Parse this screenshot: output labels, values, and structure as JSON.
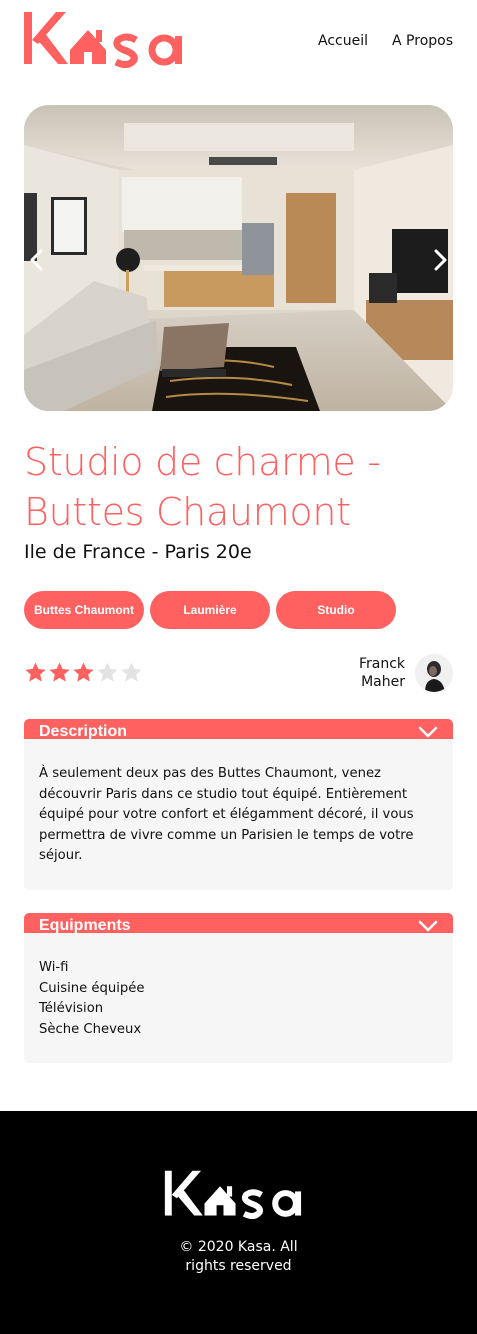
{
  "brand": {
    "logo_text": "Kasa",
    "accent_color": "#FF6060"
  },
  "nav": {
    "items": [
      {
        "label": "Accueil"
      },
      {
        "label": "A Propos"
      }
    ]
  },
  "carousel": {
    "prev_icon": "chevron-left-icon",
    "next_icon": "chevron-right-icon"
  },
  "listing": {
    "title": "Studio de charme - Buttes Chaumont",
    "location": "Ile de France - Paris 20e",
    "tags": [
      "Buttes Chaumont",
      "Laumière",
      "Studio"
    ],
    "rating": 3,
    "rating_max": 5,
    "host": {
      "first_name": "Franck",
      "last_name": "Maher"
    }
  },
  "description": {
    "title": "Description",
    "text": "À seulement deux pas des Buttes Chaumont, venez découvrir Paris dans ce studio tout équipé. Entièrement équipé pour votre confort et élégamment décoré, il vous permettra de vivre comme un Parisien le temps de votre séjour."
  },
  "equipments": {
    "title": "Equipments",
    "items": [
      "Wi-fi",
      "Cuisine équipée",
      "Télévision",
      "Sèche Cheveux"
    ]
  },
  "footer": {
    "logo_text": "Kasa",
    "copyright": "© 2020 Kasa. All rights reserved"
  }
}
